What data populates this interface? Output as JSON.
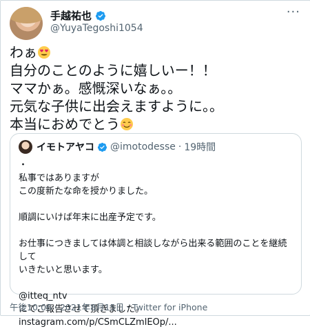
{
  "author": {
    "display_name": "手越祐也",
    "handle": "@YuyaTegoshi1054",
    "verified": true
  },
  "more_label": "···",
  "tweet": {
    "line1": "わぁ",
    "line2": "自分のことのように嬉しいー！！",
    "line3": "ママかぁ。感慨深いなぁ。。",
    "line4": "元気な子供に出会えますように。。",
    "line5": "本当におめでとう",
    "emoji1": "heart-eyes-emoji",
    "emoji2": "smiling-emoji"
  },
  "quote": {
    "display_name": "イモトアヤコ",
    "handle": "@imotodesse",
    "separator": "·",
    "time": "19時間",
    "text": "・\n私事ではありますが\nこの度新たな命を授かりました。\n\n順調にいけば年末に出産予定です。\n\nお仕事につきましては体調と相談しながら出来る範囲のことを継続して\nいきたいと思います。\n\n@itteq_ntv\nにてご報告させて頂きました。 instagram.com/p/CSmCLZmlEOp/..."
  },
  "footer": {
    "timestamp": "午後10:06 · 2021年8月15日 · Twitter for iPhone"
  },
  "colors": {
    "verified": "#1d9bf0",
    "muted": "#536471",
    "border": "#cfd9de"
  }
}
